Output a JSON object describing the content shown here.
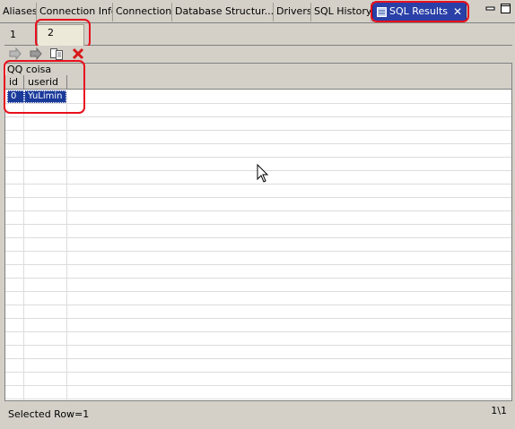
{
  "view_tabs": [
    {
      "label": "Aliases"
    },
    {
      "label": "Connection Info"
    },
    {
      "label": "Connections"
    },
    {
      "label": "Database Structur..."
    },
    {
      "label": "Drivers"
    },
    {
      "label": "SQL History"
    },
    {
      "label": "SQL Results"
    }
  ],
  "result_tabs": [
    "1",
    "2"
  ],
  "toolbar": {
    "icons": [
      "prev-icon",
      "next-icon",
      "copy-icon",
      "delete-icon"
    ]
  },
  "grid": {
    "title": "QQ coisa",
    "columns": [
      "id",
      "userid"
    ],
    "rows": [
      [
        "0",
        "YuLimin"
      ]
    ]
  },
  "status": {
    "text": "Selected Row=1",
    "page": "1\\1"
  },
  "colors": {
    "active_tab": "#2a40a8",
    "selection": "#1a3a9a",
    "highlight_box": "#e8101c"
  }
}
